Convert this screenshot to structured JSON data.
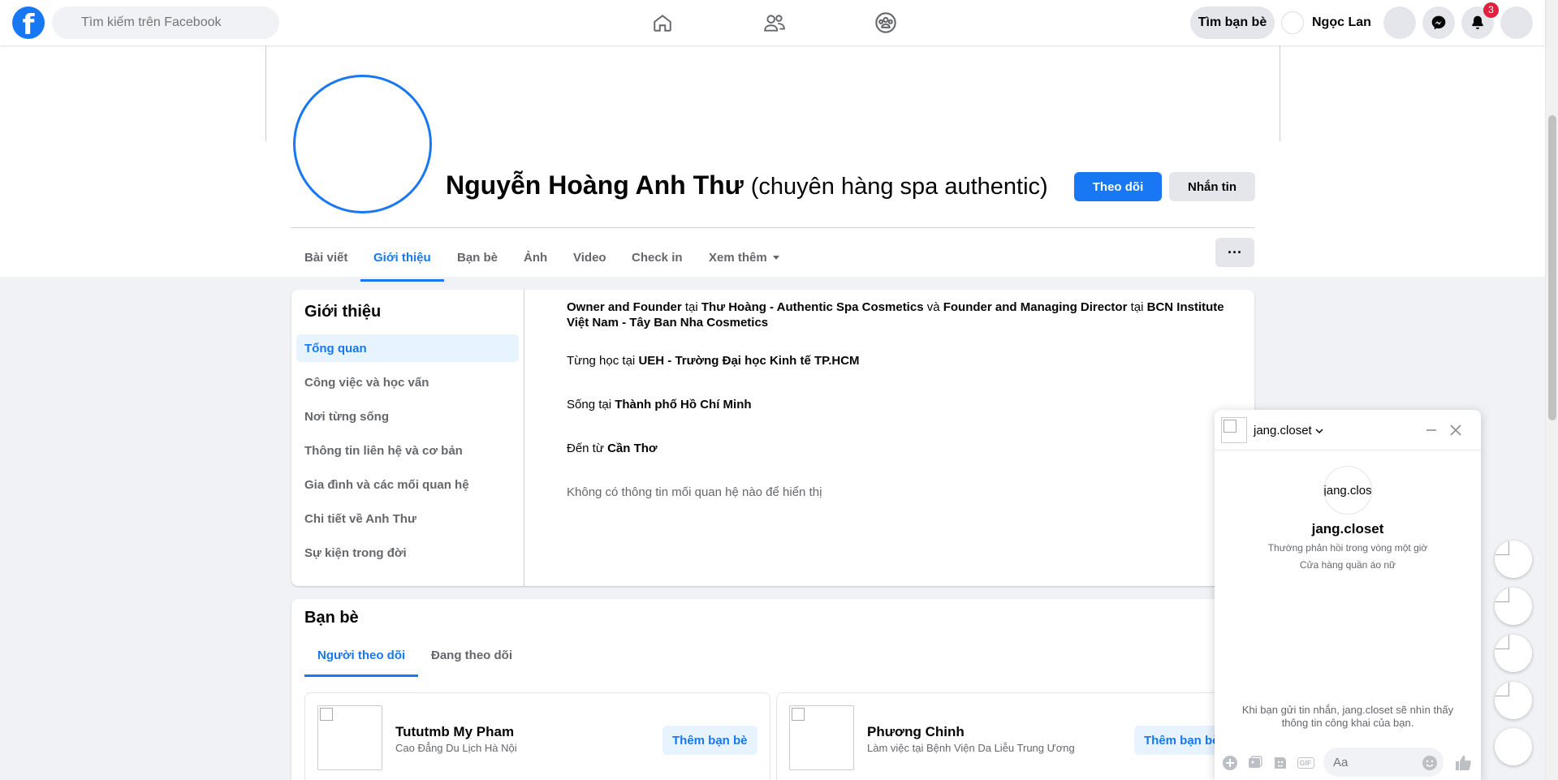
{
  "topnav": {
    "logo": "f",
    "search_placeholder": "Tìm kiếm trên Facebook",
    "find_friends": "Tìm bạn bè",
    "user_name": "Ngọc Lan",
    "notification_count": "3",
    "nav_icons": [
      "home-icon",
      "friends-icon",
      "groups-icon"
    ]
  },
  "profile": {
    "name": "Nguyễn Hoàng Anh Thư",
    "alt_name": "(chuyên hàng spa authentic)",
    "follow_label": "Theo dõi",
    "message_label": "Nhắn tin",
    "tabs": [
      "Bài viết",
      "Giới thiệu",
      "Bạn bè",
      "Ảnh",
      "Video",
      "Check in",
      "Xem thêm"
    ],
    "more_label": "···"
  },
  "about": {
    "title": "Giới thiệu",
    "menu": [
      "Tổng quan",
      "Công việc và học vấn",
      "Nơi từng sống",
      "Thông tin liên hệ và cơ bản",
      "Gia đình và các mối quan hệ",
      "Chi tiết về Anh Thư",
      "Sự kiện trong đời"
    ],
    "work": {
      "role1": "Owner and Founder",
      "at1": "tại",
      "company1": "Thư Hoàng - Authentic Spa Cosmetics",
      "and": "và",
      "role2": "Founder and Managing Director",
      "at2": "tại",
      "company2": "BCN Institute Việt Nam - Tây Ban Nha Cosmetics"
    },
    "education": {
      "prefix": "Từng học tại",
      "value": "UEH - Trường Đại học Kinh tế TP.HCM"
    },
    "lives": {
      "prefix": "Sống tại",
      "value": "Thành phố Hồ Chí Minh"
    },
    "from": {
      "prefix": "Đến từ",
      "value": "Cần Thơ"
    },
    "relationship": "Không có thông tin mối quan hệ nào để hiển thị"
  },
  "friends": {
    "title": "Bạn bè",
    "tabs": [
      "Người theo dõi",
      "Đang theo dõi"
    ],
    "list": [
      {
        "name": "Tututmb My Pham",
        "sub": "Cao Đẳng Du Lịch Hà Nội",
        "action": "Thêm bạn bè"
      },
      {
        "name": "Phương Chinh",
        "sub": "Làm việc tại Bệnh Viện Da Liễu Trung Ương",
        "action": "Thêm bạn bè"
      }
    ]
  },
  "chat": {
    "name": "jang.closet",
    "profile_pic_alt": "jang.clos",
    "display_name": "jang.closet",
    "response_time": "Thường phản hồi trong vòng một giờ",
    "category": "Cửa hàng quần áo nữ",
    "notice": "Khi bạn gửi tin nhắn, jang.closet sẽ nhìn thấy thông tin công khai của bạn.",
    "input_placeholder": "Aa",
    "gif_label": "GIF"
  },
  "colors": {
    "accent": "#1877f2",
    "badge": "#e41e3f",
    "background": "#f0f2f5"
  }
}
